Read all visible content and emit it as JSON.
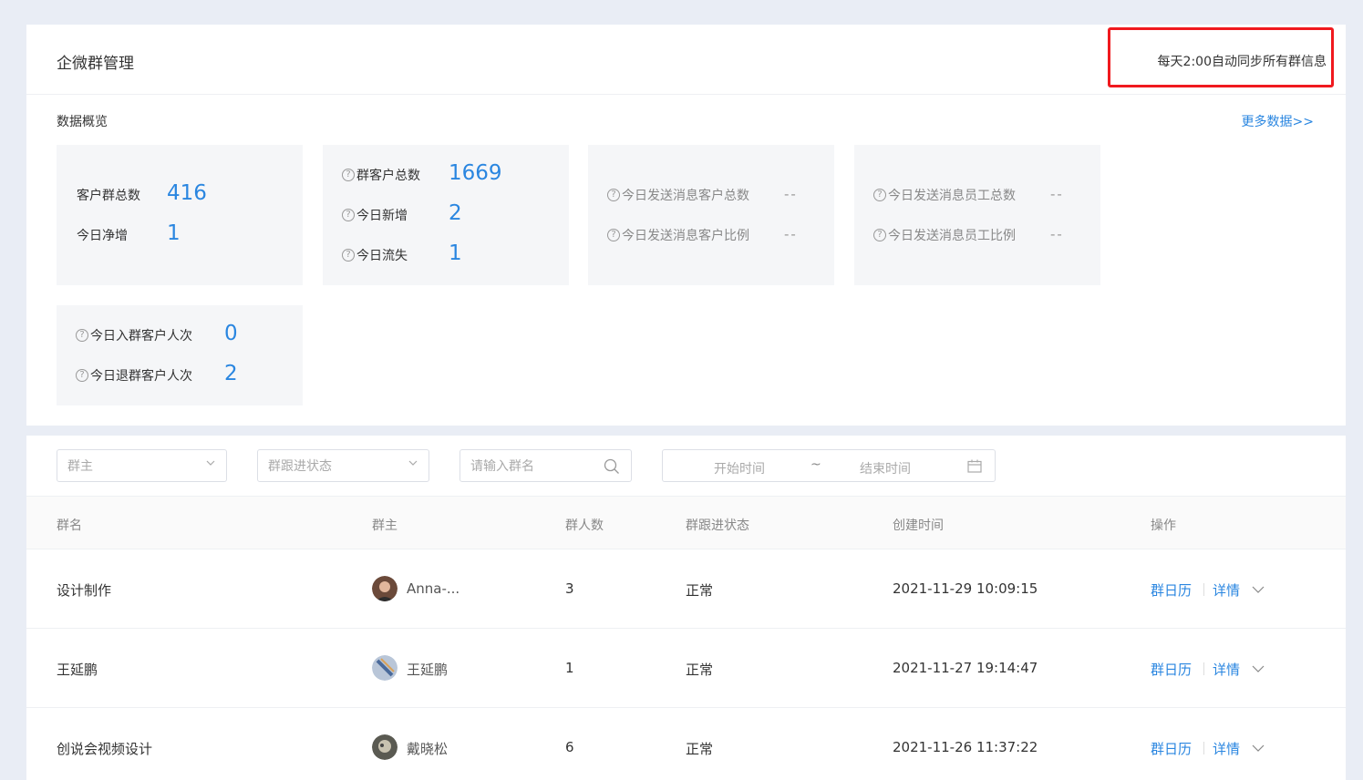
{
  "header": {
    "title": "企微群管理",
    "sync_note": "每天2:00自动同步所有群信息"
  },
  "overview": {
    "title": "数据概览",
    "more_link": "更多数据>>",
    "cards": [
      {
        "rows": [
          {
            "label": "客户群总数",
            "value": "416",
            "help": false
          },
          {
            "label": "今日净增",
            "value": "1",
            "help": false
          }
        ]
      },
      {
        "rows": [
          {
            "label": "群客户总数",
            "value": "1669",
            "help": true
          },
          {
            "label": "今日新增",
            "value": "2",
            "help": true
          },
          {
            "label": "今日流失",
            "value": "1",
            "help": true
          }
        ]
      },
      {
        "rows": [
          {
            "label": "今日发送消息客户总数",
            "value": "--",
            "help": true
          },
          {
            "label": "今日发送消息客户比例",
            "value": "--",
            "help": true
          }
        ]
      },
      {
        "rows": [
          {
            "label": "今日发送消息员工总数",
            "value": "--",
            "help": true
          },
          {
            "label": "今日发送消息员工比例",
            "value": "--",
            "help": true
          }
        ]
      },
      {
        "rows": [
          {
            "label": "今日入群客户人次",
            "value": "0",
            "help": true
          },
          {
            "label": "今日退群客户人次",
            "value": "2",
            "help": true
          }
        ]
      }
    ]
  },
  "filters": {
    "owner_placeholder": "群主",
    "status_placeholder": "群跟进状态",
    "search_placeholder": "请输入群名",
    "start_placeholder": "开始时间",
    "range_sep": "~",
    "end_placeholder": "结束时间"
  },
  "table": {
    "headers": [
      "群名",
      "群主",
      "群人数",
      "群跟进状态",
      "创建时间",
      "操作"
    ],
    "rows": [
      {
        "name": "设计制作",
        "owner": "Anna-...",
        "count": "3",
        "status": "正常",
        "created": "2021-11-29 10:09:15",
        "op1": "群日历",
        "op2": "详情"
      },
      {
        "name": "王延鹏",
        "owner": "王延鹏",
        "count": "1",
        "status": "正常",
        "created": "2021-11-27 19:14:47",
        "op1": "群日历",
        "op2": "详情"
      },
      {
        "name": "创说会视频设计",
        "owner": "戴晓松",
        "count": "6",
        "status": "正常",
        "created": "2021-11-26 11:37:22",
        "op1": "群日历",
        "op2": "详情"
      }
    ]
  },
  "colors": {
    "accent": "#2a86e0",
    "highlight_border": "#f0191e",
    "page_bg": "#e9edf5",
    "card_bg": "#f5f6f8"
  },
  "icons": [
    "help-circle-icon",
    "chevron-down-icon",
    "search-icon",
    "calendar-icon"
  ]
}
